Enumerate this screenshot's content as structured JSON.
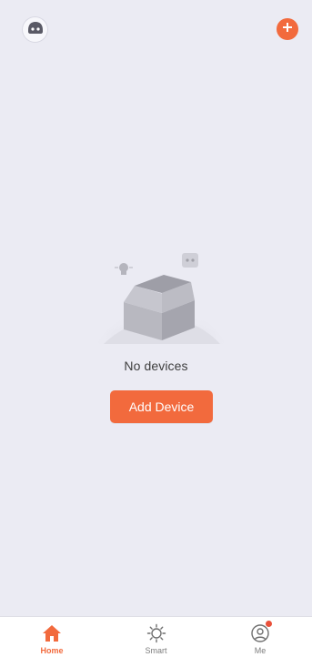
{
  "colors": {
    "background": "#ebebf3",
    "accent": "#f26a3d",
    "nav_background": "#ffffff",
    "text_dark": "#3d3d3d",
    "text_muted": "#7d7d7d"
  },
  "header": {
    "avatar_icon": "robot-avatar-icon",
    "add_icon": "plus-icon"
  },
  "empty_state": {
    "illustration": "open-box-illustration",
    "message": "No devices",
    "button_label": "Add Device"
  },
  "bottom_nav": {
    "items": [
      {
        "label": "Home",
        "icon": "home-icon",
        "active": true
      },
      {
        "label": "Smart",
        "icon": "sun-icon",
        "active": false
      },
      {
        "label": "Me",
        "icon": "user-icon",
        "active": false,
        "badge": true
      }
    ]
  }
}
